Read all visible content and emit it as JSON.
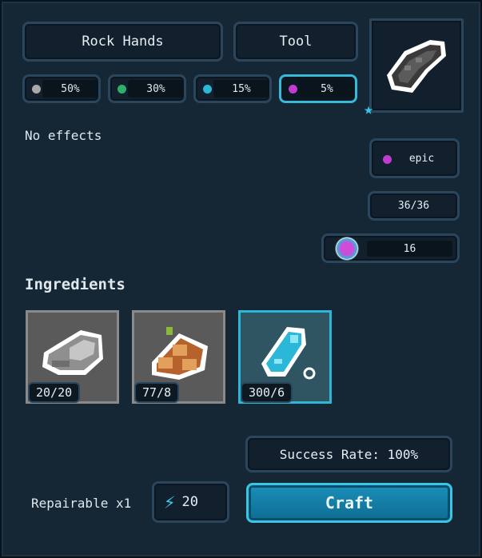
{
  "item": {
    "name": "Rock Hands",
    "type": "Tool",
    "effects": "No effects",
    "rarity": "epic",
    "durability": "36/36",
    "level": "16"
  },
  "chances": [
    {
      "value": "50%",
      "color": "#a9a9a9"
    },
    {
      "value": "30%",
      "color": "#2fb06a"
    },
    {
      "value": "15%",
      "color": "#2bb8d8"
    },
    {
      "value": "5%",
      "color": "#c23bd0"
    }
  ],
  "ingredients_title": "Ingredients",
  "ingredients": [
    {
      "name": "stone",
      "count": "20/20"
    },
    {
      "name": "wood logs",
      "count": "77/8"
    },
    {
      "name": "blue scroll",
      "count": "300/6"
    }
  ],
  "success_rate": "Success Rate: 100%",
  "repairable": "Repairable x1",
  "energy_cost": "20",
  "craft_label": "Craft"
}
